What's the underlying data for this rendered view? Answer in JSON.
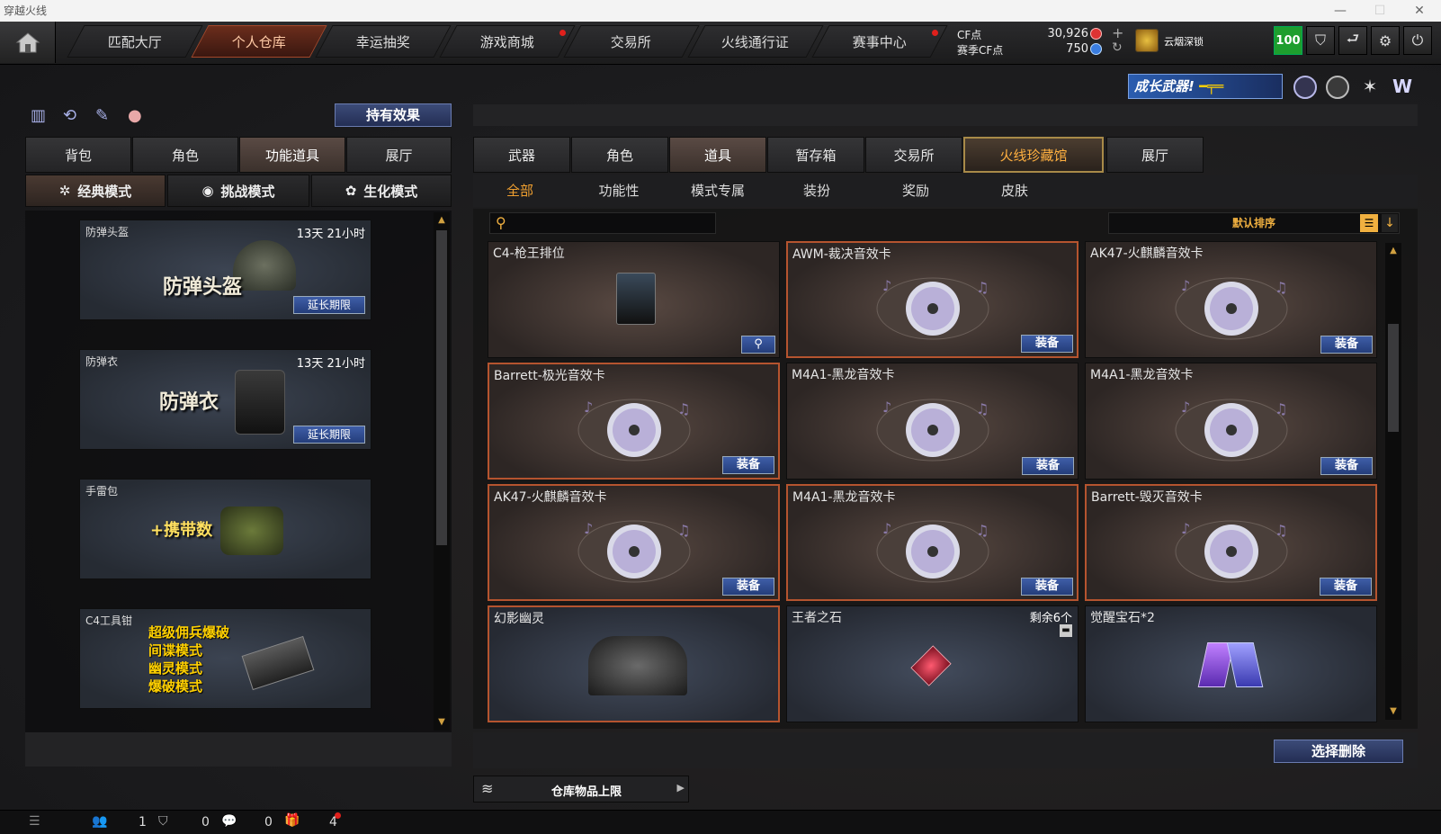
{
  "window": {
    "title": "穿越火线"
  },
  "nav": {
    "tabs": [
      "匹配大厅",
      "个人仓库",
      "幸运抽奖",
      "游戏商城",
      "交易所",
      "火线通行证",
      "赛事中心"
    ]
  },
  "currency": {
    "cf_label": "CF点",
    "cf_value": "30,926",
    "season_label": "赛季CF点",
    "season_value": "750"
  },
  "user": {
    "name": "云烟深锁",
    "level_badge": "100"
  },
  "promo": {
    "text": "成长武器!"
  },
  "left": {
    "effect_button": "持有效果",
    "tabs": [
      "背包",
      "角色",
      "功能道具",
      "展厅"
    ],
    "modes": [
      "经典模式",
      "挑战模式",
      "生化模式"
    ],
    "cards": [
      {
        "name": "防弹头盔",
        "time": "13天 21小时",
        "big": "防弹头盔",
        "action": "延长期限"
      },
      {
        "name": "防弹衣",
        "time": "13天 21小时",
        "big": "防弹衣",
        "action": "延长期限"
      },
      {
        "name": "手雷包",
        "big": "+携带数"
      },
      {
        "name": "C4工具钳",
        "modes": [
          "超级佣兵爆破",
          "间谍模式",
          "幽灵模式",
          "爆破模式"
        ]
      }
    ]
  },
  "right": {
    "tabs": [
      "武器",
      "角色",
      "道具",
      "暂存箱",
      "交易所",
      "火线珍藏馆",
      "展厅"
    ],
    "subtabs": [
      "全部",
      "功能性",
      "模式专属",
      "装扮",
      "奖励",
      "皮肤"
    ],
    "sort_label": "默认排序",
    "items": [
      {
        "name": "C4-枪王排位"
      },
      {
        "name": "AWM-裁决音效卡",
        "action": "装备"
      },
      {
        "name": "AK47-火麒麟音效卡",
        "action": "装备"
      },
      {
        "name": "Barrett-极光音效卡",
        "action": "装备"
      },
      {
        "name": "M4A1-黑龙音效卡",
        "action": "装备"
      },
      {
        "name": "M4A1-黑龙音效卡",
        "action": "装备"
      },
      {
        "name": "AK47-火麒麟音效卡",
        "action": "装备"
      },
      {
        "name": "M4A1-黑龙音效卡",
        "action": "装备"
      },
      {
        "name": "Barrett-毁灭音效卡",
        "action": "装备"
      },
      {
        "name": "幻影幽灵"
      },
      {
        "name": "王者之石",
        "remain": "剩余6个"
      },
      {
        "name": "觉醒宝石*2"
      }
    ],
    "delete_button": "选择删除",
    "storage_limit": "仓库物品上限"
  },
  "status": {
    "friends": "1",
    "clan": "0",
    "chat": "0",
    "gifts": "4"
  }
}
